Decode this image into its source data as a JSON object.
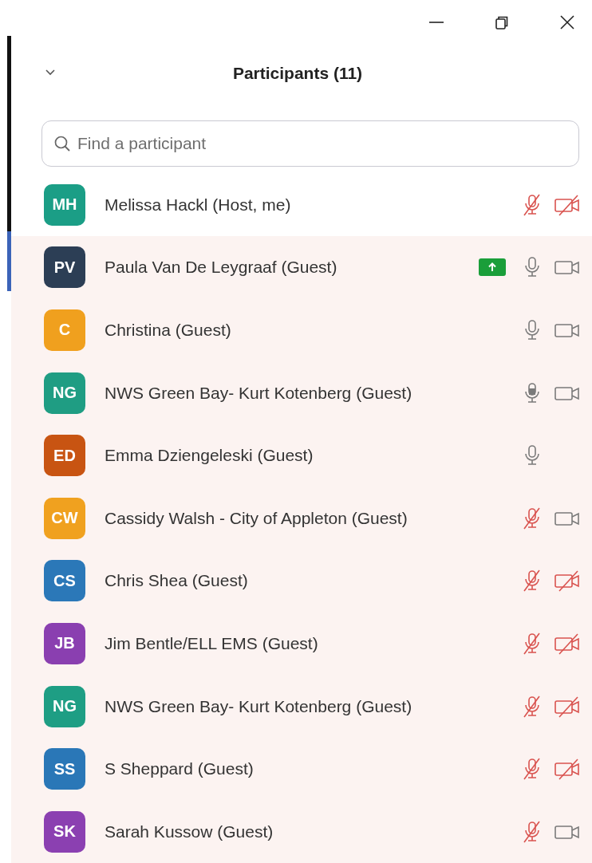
{
  "header": {
    "title": "Participants (11)"
  },
  "search": {
    "placeholder": "Find a participant"
  },
  "participants": [
    {
      "initials": "MH",
      "color": "#1b9e86",
      "name": "Melissa Hackl (Host, me)",
      "shaded": false,
      "sharing": false,
      "mic_muted": true,
      "speaking": false,
      "video_shown": true,
      "video_off": true
    },
    {
      "initials": "PV",
      "color": "#2c3e55",
      "name": "Paula Van De Leygraaf (Guest)",
      "shaded": true,
      "sharing": true,
      "mic_muted": false,
      "speaking": false,
      "video_shown": true,
      "video_off": false
    },
    {
      "initials": "C",
      "color": "#f0a01e",
      "name": "Christina (Guest)",
      "shaded": true,
      "sharing": false,
      "mic_muted": false,
      "speaking": false,
      "video_shown": true,
      "video_off": false
    },
    {
      "initials": "NG",
      "color": "#1f9d83",
      "name": "NWS Green Bay- Kurt Kotenberg (Guest)",
      "shaded": true,
      "sharing": false,
      "mic_muted": false,
      "speaking": true,
      "video_shown": true,
      "video_off": false
    },
    {
      "initials": "ED",
      "color": "#c85412",
      "name": "Emma Dziengeleski (Guest)",
      "shaded": true,
      "sharing": false,
      "mic_muted": false,
      "speaking": false,
      "video_shown": false,
      "video_off": false
    },
    {
      "initials": "CW",
      "color": "#f0a11f",
      "name": "Cassidy Walsh - City of Appleton (Guest)",
      "shaded": true,
      "sharing": false,
      "mic_muted": true,
      "speaking": false,
      "video_shown": true,
      "video_off": false
    },
    {
      "initials": "CS",
      "color": "#2b78b8",
      "name": "Chris Shea (Guest)",
      "shaded": true,
      "sharing": false,
      "mic_muted": true,
      "speaking": false,
      "video_shown": true,
      "video_off": true
    },
    {
      "initials": "JB",
      "color": "#8a3fb0",
      "name": "Jim Bentle/ELL EMS (Guest)",
      "shaded": true,
      "sharing": false,
      "mic_muted": true,
      "speaking": false,
      "video_shown": true,
      "video_off": true
    },
    {
      "initials": "NG",
      "color": "#1e9e84",
      "name": "NWS Green Bay- Kurt Kotenberg (Guest)",
      "shaded": true,
      "sharing": false,
      "mic_muted": true,
      "speaking": false,
      "video_shown": true,
      "video_off": true
    },
    {
      "initials": "SS",
      "color": "#2a77b7",
      "name": "S Sheppard (Guest)",
      "shaded": true,
      "sharing": false,
      "mic_muted": true,
      "speaking": false,
      "video_shown": true,
      "video_off": true
    },
    {
      "initials": "SK",
      "color": "#8b40b1",
      "name": "Sarah Kussow (Guest)",
      "shaded": true,
      "sharing": false,
      "mic_muted": true,
      "speaking": false,
      "video_shown": true,
      "video_off": false
    }
  ]
}
